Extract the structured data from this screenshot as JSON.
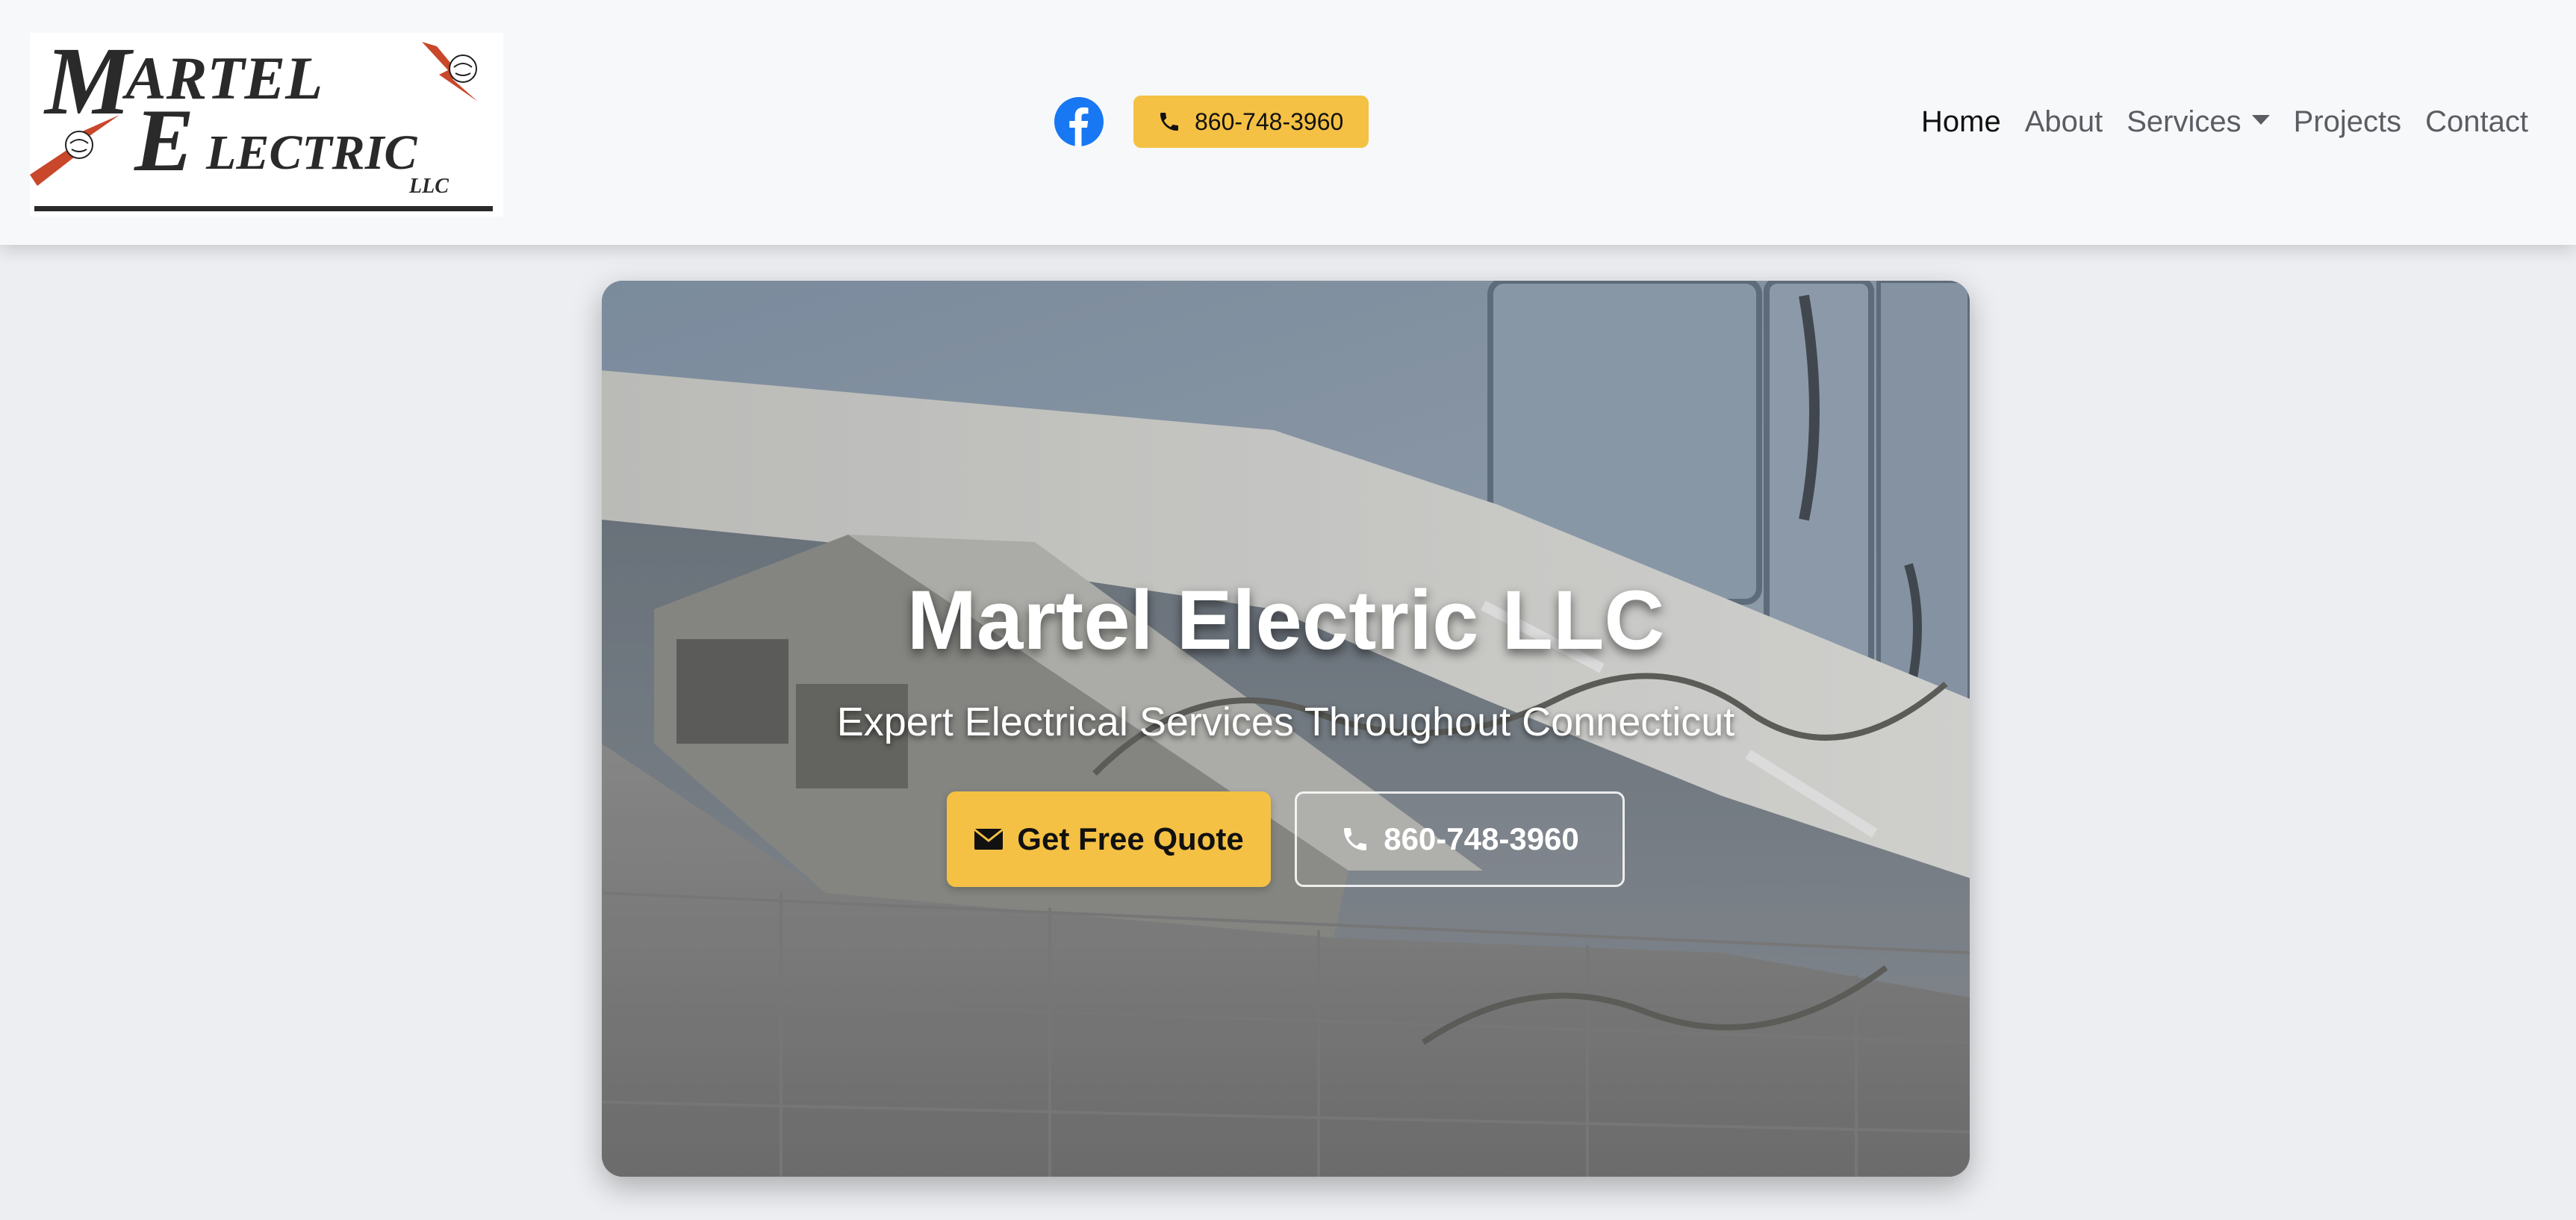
{
  "brand": {
    "logo_line1": "ARTEL",
    "logo_line2": "LECTRIC",
    "logo_suffix": "LLC",
    "logo_initial_1": "M",
    "logo_initial_2": "E",
    "accent_color": "#f4c144",
    "logo_bolt_color": "#c9472b"
  },
  "header": {
    "social_icon": "facebook-icon",
    "phone_icon": "phone-icon",
    "phone": "860-748-3960"
  },
  "nav": {
    "items": [
      {
        "label": "Home",
        "active": true
      },
      {
        "label": "About"
      },
      {
        "label": "Services",
        "dropdown": true
      },
      {
        "label": "Projects"
      },
      {
        "label": "Contact"
      }
    ]
  },
  "hero": {
    "title": "Martel Electric LLC",
    "subtitle": "Expert Electrical Services Throughout Connecticut",
    "cta_primary": "Get Free Quote",
    "cta_primary_icon": "envelope-icon",
    "cta_secondary": "860-748-3960",
    "cta_secondary_icon": "phone-icon"
  }
}
